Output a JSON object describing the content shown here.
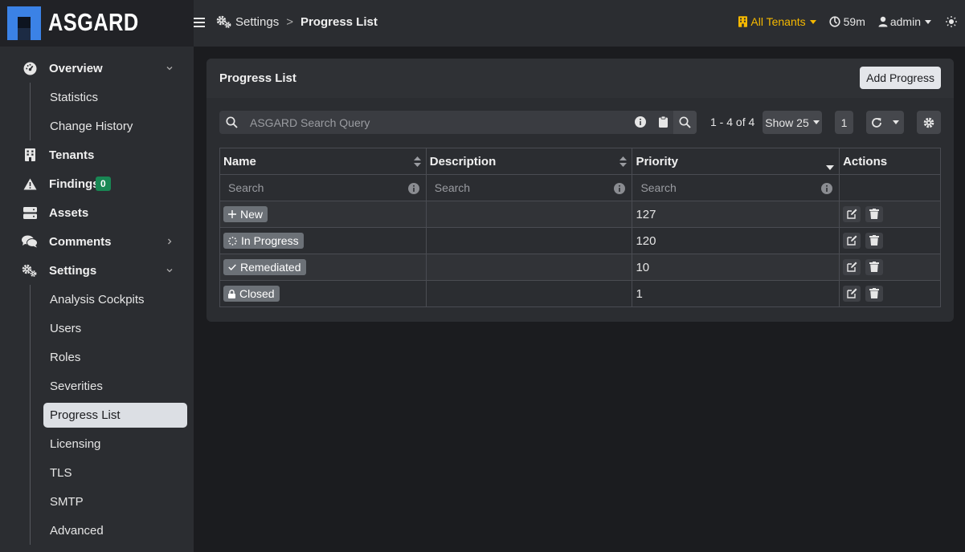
{
  "brand": {
    "name": "ASGARD"
  },
  "topbar": {
    "breadcrumb_parent": "Settings",
    "breadcrumb_separator": ">",
    "breadcrumb_current": "Progress List",
    "tenants_label": "All Tenants",
    "timer": "59m",
    "user": "admin"
  },
  "sidebar": {
    "items": [
      {
        "label": "Overview"
      },
      {
        "label": "Statistics"
      },
      {
        "label": "Change History"
      },
      {
        "label": "Tenants"
      },
      {
        "label": "Findings",
        "badge": "0"
      },
      {
        "label": "Assets"
      },
      {
        "label": "Comments"
      },
      {
        "label": "Settings"
      },
      {
        "label": "Analysis Cockpits"
      },
      {
        "label": "Users"
      },
      {
        "label": "Roles"
      },
      {
        "label": "Severities"
      },
      {
        "label": "Progress List"
      },
      {
        "label": "Licensing"
      },
      {
        "label": "TLS"
      },
      {
        "label": "SMTP"
      },
      {
        "label": "Advanced"
      }
    ]
  },
  "card": {
    "title": "Progress List",
    "add_button": "Add Progress"
  },
  "toolbar": {
    "search_placeholder": "ASGARD Search Query",
    "pager_info": "1 - 4 of 4",
    "show_label": "Show 25",
    "page_number": "1"
  },
  "table": {
    "columns": [
      "Name",
      "Description",
      "Priority",
      "Actions"
    ],
    "filter_placeholder": "Search",
    "rows": [
      {
        "name": "New",
        "description": "",
        "priority": "127"
      },
      {
        "name": "In Progress",
        "description": "",
        "priority": "120"
      },
      {
        "name": "Remediated",
        "description": "",
        "priority": "10"
      },
      {
        "name": "Closed",
        "description": "",
        "priority": "1"
      }
    ]
  },
  "colors": {
    "accent_yellow": "#f5b800",
    "badge_green": "#198754",
    "logo_blue": "#3b82e6"
  }
}
